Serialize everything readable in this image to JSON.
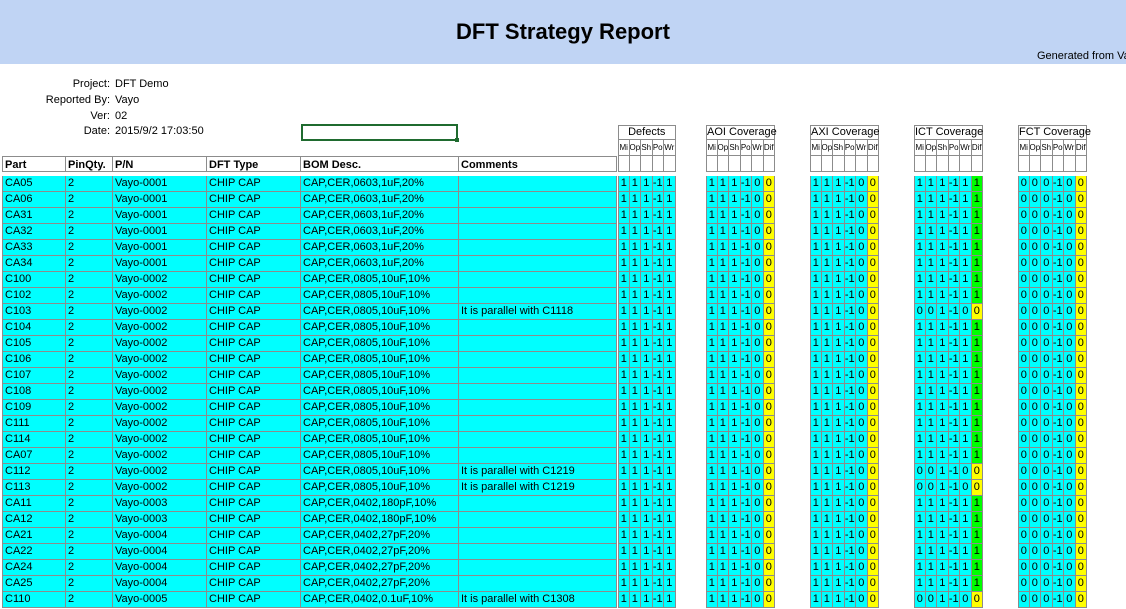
{
  "report": {
    "title": "DFT Strategy Report",
    "generated": "Generated from Va"
  },
  "meta": [
    {
      "label": "Project:",
      "value": "DFT Demo"
    },
    {
      "label": "Reported By:",
      "value": "Vayo"
    },
    {
      "label": "Ver:",
      "value": "02"
    },
    {
      "label": "Date:",
      "value": "2015/9/2 17:03:50"
    }
  ],
  "columns": {
    "part": "Part",
    "pinqty": "PinQty.",
    "pn": "P/N",
    "dft_type": "DFT Type",
    "bom_desc": "BOM Desc.",
    "comments": "Comments"
  },
  "groups": [
    {
      "title": "Defects",
      "subs": [
        "Mi",
        "Op",
        "Sh",
        "Po",
        "Wr"
      ]
    },
    {
      "title": "AOI Coverage",
      "subs": [
        "Mi",
        "Op",
        "Sh",
        "Po",
        "Wr",
        "Dif"
      ]
    },
    {
      "title": "AXI Coverage",
      "subs": [
        "Mi",
        "Op",
        "Sh",
        "Po",
        "Wr",
        "Dif"
      ]
    },
    {
      "title": "ICT Coverage",
      "subs": [
        "Mi",
        "Op",
        "Sh",
        "Po",
        "Wr",
        "Dif"
      ]
    },
    {
      "title": "FCT Coverage",
      "subs": [
        "Mi",
        "Op",
        "Sh",
        "Po",
        "Wr",
        "Dif"
      ]
    }
  ],
  "rows": [
    {
      "part": "CA05",
      "pinqty": "2",
      "pn": "Vayo-0001",
      "type": "CHIP CAP",
      "desc": "CAP,CER,0603,1uF,20%",
      "comment": "",
      "defects": [
        "1",
        "1",
        "1",
        "-1",
        "1"
      ],
      "aoi": [
        "1",
        "1",
        "1",
        "-1",
        "0",
        "0"
      ],
      "axi": [
        "1",
        "1",
        "1",
        "-1",
        "0",
        "0"
      ],
      "ict": [
        "1",
        "1",
        "1",
        "-1",
        "1",
        "1"
      ],
      "fct": [
        "0",
        "0",
        "0",
        "-1",
        "0",
        "0"
      ]
    },
    {
      "part": "CA06",
      "pinqty": "2",
      "pn": "Vayo-0001",
      "type": "CHIP CAP",
      "desc": "CAP,CER,0603,1uF,20%",
      "comment": "",
      "defects": [
        "1",
        "1",
        "1",
        "-1",
        "1"
      ],
      "aoi": [
        "1",
        "1",
        "1",
        "-1",
        "0",
        "0"
      ],
      "axi": [
        "1",
        "1",
        "1",
        "-1",
        "0",
        "0"
      ],
      "ict": [
        "1",
        "1",
        "1",
        "-1",
        "1",
        "1"
      ],
      "fct": [
        "0",
        "0",
        "0",
        "-1",
        "0",
        "0"
      ]
    },
    {
      "part": "CA31",
      "pinqty": "2",
      "pn": "Vayo-0001",
      "type": "CHIP CAP",
      "desc": "CAP,CER,0603,1uF,20%",
      "comment": "",
      "defects": [
        "1",
        "1",
        "1",
        "-1",
        "1"
      ],
      "aoi": [
        "1",
        "1",
        "1",
        "-1",
        "0",
        "0"
      ],
      "axi": [
        "1",
        "1",
        "1",
        "-1",
        "0",
        "0"
      ],
      "ict": [
        "1",
        "1",
        "1",
        "-1",
        "1",
        "1"
      ],
      "fct": [
        "0",
        "0",
        "0",
        "-1",
        "0",
        "0"
      ]
    },
    {
      "part": "CA32",
      "pinqty": "2",
      "pn": "Vayo-0001",
      "type": "CHIP CAP",
      "desc": "CAP,CER,0603,1uF,20%",
      "comment": "",
      "defects": [
        "1",
        "1",
        "1",
        "-1",
        "1"
      ],
      "aoi": [
        "1",
        "1",
        "1",
        "-1",
        "0",
        "0"
      ],
      "axi": [
        "1",
        "1",
        "1",
        "-1",
        "0",
        "0"
      ],
      "ict": [
        "1",
        "1",
        "1",
        "-1",
        "1",
        "1"
      ],
      "fct": [
        "0",
        "0",
        "0",
        "-1",
        "0",
        "0"
      ]
    },
    {
      "part": "CA33",
      "pinqty": "2",
      "pn": "Vayo-0001",
      "type": "CHIP CAP",
      "desc": "CAP,CER,0603,1uF,20%",
      "comment": "",
      "defects": [
        "1",
        "1",
        "1",
        "-1",
        "1"
      ],
      "aoi": [
        "1",
        "1",
        "1",
        "-1",
        "0",
        "0"
      ],
      "axi": [
        "1",
        "1",
        "1",
        "-1",
        "0",
        "0"
      ],
      "ict": [
        "1",
        "1",
        "1",
        "-1",
        "1",
        "1"
      ],
      "fct": [
        "0",
        "0",
        "0",
        "-1",
        "0",
        "0"
      ]
    },
    {
      "part": "CA34",
      "pinqty": "2",
      "pn": "Vayo-0001",
      "type": "CHIP CAP",
      "desc": "CAP,CER,0603,1uF,20%",
      "comment": "",
      "defects": [
        "1",
        "1",
        "1",
        "-1",
        "1"
      ],
      "aoi": [
        "1",
        "1",
        "1",
        "-1",
        "0",
        "0"
      ],
      "axi": [
        "1",
        "1",
        "1",
        "-1",
        "0",
        "0"
      ],
      "ict": [
        "1",
        "1",
        "1",
        "-1",
        "1",
        "1"
      ],
      "fct": [
        "0",
        "0",
        "0",
        "-1",
        "0",
        "0"
      ]
    },
    {
      "part": "C100",
      "pinqty": "2",
      "pn": "Vayo-0002",
      "type": "CHIP CAP",
      "desc": "CAP,CER,0805,10uF,10%",
      "comment": "",
      "defects": [
        "1",
        "1",
        "1",
        "-1",
        "1"
      ],
      "aoi": [
        "1",
        "1",
        "1",
        "-1",
        "0",
        "0"
      ],
      "axi": [
        "1",
        "1",
        "1",
        "-1",
        "0",
        "0"
      ],
      "ict": [
        "1",
        "1",
        "1",
        "-1",
        "1",
        "1"
      ],
      "fct": [
        "0",
        "0",
        "0",
        "-1",
        "0",
        "0"
      ]
    },
    {
      "part": "C102",
      "pinqty": "2",
      "pn": "Vayo-0002",
      "type": "CHIP CAP",
      "desc": "CAP,CER,0805,10uF,10%",
      "comment": "",
      "defects": [
        "1",
        "1",
        "1",
        "-1",
        "1"
      ],
      "aoi": [
        "1",
        "1",
        "1",
        "-1",
        "0",
        "0"
      ],
      "axi": [
        "1",
        "1",
        "1",
        "-1",
        "0",
        "0"
      ],
      "ict": [
        "1",
        "1",
        "1",
        "-1",
        "1",
        "1"
      ],
      "fct": [
        "0",
        "0",
        "0",
        "-1",
        "0",
        "0"
      ]
    },
    {
      "part": "C103",
      "pinqty": "2",
      "pn": "Vayo-0002",
      "type": "CHIP CAP",
      "desc": "CAP,CER,0805,10uF,10%",
      "comment": "It is parallel with C1118",
      "defects": [
        "1",
        "1",
        "1",
        "-1",
        "1"
      ],
      "aoi": [
        "1",
        "1",
        "1",
        "-1",
        "0",
        "0"
      ],
      "axi": [
        "1",
        "1",
        "1",
        "-1",
        "0",
        "0"
      ],
      "ict": [
        "0",
        "0",
        "1",
        "-1",
        "0",
        "0"
      ],
      "fct": [
        "0",
        "0",
        "0",
        "-1",
        "0",
        "0"
      ]
    },
    {
      "part": "C104",
      "pinqty": "2",
      "pn": "Vayo-0002",
      "type": "CHIP CAP",
      "desc": "CAP,CER,0805,10uF,10%",
      "comment": "",
      "defects": [
        "1",
        "1",
        "1",
        "-1",
        "1"
      ],
      "aoi": [
        "1",
        "1",
        "1",
        "-1",
        "0",
        "0"
      ],
      "axi": [
        "1",
        "1",
        "1",
        "-1",
        "0",
        "0"
      ],
      "ict": [
        "1",
        "1",
        "1",
        "-1",
        "1",
        "1"
      ],
      "fct": [
        "0",
        "0",
        "0",
        "-1",
        "0",
        "0"
      ]
    },
    {
      "part": "C105",
      "pinqty": "2",
      "pn": "Vayo-0002",
      "type": "CHIP CAP",
      "desc": "CAP,CER,0805,10uF,10%",
      "comment": "",
      "defects": [
        "1",
        "1",
        "1",
        "-1",
        "1"
      ],
      "aoi": [
        "1",
        "1",
        "1",
        "-1",
        "0",
        "0"
      ],
      "axi": [
        "1",
        "1",
        "1",
        "-1",
        "0",
        "0"
      ],
      "ict": [
        "1",
        "1",
        "1",
        "-1",
        "1",
        "1"
      ],
      "fct": [
        "0",
        "0",
        "0",
        "-1",
        "0",
        "0"
      ]
    },
    {
      "part": "C106",
      "pinqty": "2",
      "pn": "Vayo-0002",
      "type": "CHIP CAP",
      "desc": "CAP,CER,0805,10uF,10%",
      "comment": "",
      "defects": [
        "1",
        "1",
        "1",
        "-1",
        "1"
      ],
      "aoi": [
        "1",
        "1",
        "1",
        "-1",
        "0",
        "0"
      ],
      "axi": [
        "1",
        "1",
        "1",
        "-1",
        "0",
        "0"
      ],
      "ict": [
        "1",
        "1",
        "1",
        "-1",
        "1",
        "1"
      ],
      "fct": [
        "0",
        "0",
        "0",
        "-1",
        "0",
        "0"
      ]
    },
    {
      "part": "C107",
      "pinqty": "2",
      "pn": "Vayo-0002",
      "type": "CHIP CAP",
      "desc": "CAP,CER,0805,10uF,10%",
      "comment": "",
      "defects": [
        "1",
        "1",
        "1",
        "-1",
        "1"
      ],
      "aoi": [
        "1",
        "1",
        "1",
        "-1",
        "0",
        "0"
      ],
      "axi": [
        "1",
        "1",
        "1",
        "-1",
        "0",
        "0"
      ],
      "ict": [
        "1",
        "1",
        "1",
        "-1",
        "1",
        "1"
      ],
      "fct": [
        "0",
        "0",
        "0",
        "-1",
        "0",
        "0"
      ]
    },
    {
      "part": "C108",
      "pinqty": "2",
      "pn": "Vayo-0002",
      "type": "CHIP CAP",
      "desc": "CAP,CER,0805,10uF,10%",
      "comment": "",
      "defects": [
        "1",
        "1",
        "1",
        "-1",
        "1"
      ],
      "aoi": [
        "1",
        "1",
        "1",
        "-1",
        "0",
        "0"
      ],
      "axi": [
        "1",
        "1",
        "1",
        "-1",
        "0",
        "0"
      ],
      "ict": [
        "1",
        "1",
        "1",
        "-1",
        "1",
        "1"
      ],
      "fct": [
        "0",
        "0",
        "0",
        "-1",
        "0",
        "0"
      ]
    },
    {
      "part": "C109",
      "pinqty": "2",
      "pn": "Vayo-0002",
      "type": "CHIP CAP",
      "desc": "CAP,CER,0805,10uF,10%",
      "comment": "",
      "defects": [
        "1",
        "1",
        "1",
        "-1",
        "1"
      ],
      "aoi": [
        "1",
        "1",
        "1",
        "-1",
        "0",
        "0"
      ],
      "axi": [
        "1",
        "1",
        "1",
        "-1",
        "0",
        "0"
      ],
      "ict": [
        "1",
        "1",
        "1",
        "-1",
        "1",
        "1"
      ],
      "fct": [
        "0",
        "0",
        "0",
        "-1",
        "0",
        "0"
      ]
    },
    {
      "part": "C111",
      "pinqty": "2",
      "pn": "Vayo-0002",
      "type": "CHIP CAP",
      "desc": "CAP,CER,0805,10uF,10%",
      "comment": "",
      "defects": [
        "1",
        "1",
        "1",
        "-1",
        "1"
      ],
      "aoi": [
        "1",
        "1",
        "1",
        "-1",
        "0",
        "0"
      ],
      "axi": [
        "1",
        "1",
        "1",
        "-1",
        "0",
        "0"
      ],
      "ict": [
        "1",
        "1",
        "1",
        "-1",
        "1",
        "1"
      ],
      "fct": [
        "0",
        "0",
        "0",
        "-1",
        "0",
        "0"
      ]
    },
    {
      "part": "C114",
      "pinqty": "2",
      "pn": "Vayo-0002",
      "type": "CHIP CAP",
      "desc": "CAP,CER,0805,10uF,10%",
      "comment": "",
      "defects": [
        "1",
        "1",
        "1",
        "-1",
        "1"
      ],
      "aoi": [
        "1",
        "1",
        "1",
        "-1",
        "0",
        "0"
      ],
      "axi": [
        "1",
        "1",
        "1",
        "-1",
        "0",
        "0"
      ],
      "ict": [
        "1",
        "1",
        "1",
        "-1",
        "1",
        "1"
      ],
      "fct": [
        "0",
        "0",
        "0",
        "-1",
        "0",
        "0"
      ]
    },
    {
      "part": "CA07",
      "pinqty": "2",
      "pn": "Vayo-0002",
      "type": "CHIP CAP",
      "desc": "CAP,CER,0805,10uF,10%",
      "comment": "",
      "defects": [
        "1",
        "1",
        "1",
        "-1",
        "1"
      ],
      "aoi": [
        "1",
        "1",
        "1",
        "-1",
        "0",
        "0"
      ],
      "axi": [
        "1",
        "1",
        "1",
        "-1",
        "0",
        "0"
      ],
      "ict": [
        "1",
        "1",
        "1",
        "-1",
        "1",
        "1"
      ],
      "fct": [
        "0",
        "0",
        "0",
        "-1",
        "0",
        "0"
      ]
    },
    {
      "part": "C112",
      "pinqty": "2",
      "pn": "Vayo-0002",
      "type": "CHIP CAP",
      "desc": "CAP,CER,0805,10uF,10%",
      "comment": "It is parallel with C1219",
      "defects": [
        "1",
        "1",
        "1",
        "-1",
        "1"
      ],
      "aoi": [
        "1",
        "1",
        "1",
        "-1",
        "0",
        "0"
      ],
      "axi": [
        "1",
        "1",
        "1",
        "-1",
        "0",
        "0"
      ],
      "ict": [
        "0",
        "0",
        "1",
        "-1",
        "0",
        "0"
      ],
      "fct": [
        "0",
        "0",
        "0",
        "-1",
        "0",
        "0"
      ]
    },
    {
      "part": "C113",
      "pinqty": "2",
      "pn": "Vayo-0002",
      "type": "CHIP CAP",
      "desc": "CAP,CER,0805,10uF,10%",
      "comment": "It is parallel with C1219",
      "defects": [
        "1",
        "1",
        "1",
        "-1",
        "1"
      ],
      "aoi": [
        "1",
        "1",
        "1",
        "-1",
        "0",
        "0"
      ],
      "axi": [
        "1",
        "1",
        "1",
        "-1",
        "0",
        "0"
      ],
      "ict": [
        "0",
        "0",
        "1",
        "-1",
        "0",
        "0"
      ],
      "fct": [
        "0",
        "0",
        "0",
        "-1",
        "0",
        "0"
      ]
    },
    {
      "part": "CA11",
      "pinqty": "2",
      "pn": "Vayo-0003",
      "type": "CHIP CAP",
      "desc": "CAP,CER,0402,180pF,10%",
      "comment": "",
      "defects": [
        "1",
        "1",
        "1",
        "-1",
        "1"
      ],
      "aoi": [
        "1",
        "1",
        "1",
        "-1",
        "0",
        "0"
      ],
      "axi": [
        "1",
        "1",
        "1",
        "-1",
        "0",
        "0"
      ],
      "ict": [
        "1",
        "1",
        "1",
        "-1",
        "1",
        "1"
      ],
      "fct": [
        "0",
        "0",
        "0",
        "-1",
        "0",
        "0"
      ]
    },
    {
      "part": "CA12",
      "pinqty": "2",
      "pn": "Vayo-0003",
      "type": "CHIP CAP",
      "desc": "CAP,CER,0402,180pF,10%",
      "comment": "",
      "defects": [
        "1",
        "1",
        "1",
        "-1",
        "1"
      ],
      "aoi": [
        "1",
        "1",
        "1",
        "-1",
        "0",
        "0"
      ],
      "axi": [
        "1",
        "1",
        "1",
        "-1",
        "0",
        "0"
      ],
      "ict": [
        "1",
        "1",
        "1",
        "-1",
        "1",
        "1"
      ],
      "fct": [
        "0",
        "0",
        "0",
        "-1",
        "0",
        "0"
      ]
    },
    {
      "part": "CA21",
      "pinqty": "2",
      "pn": "Vayo-0004",
      "type": "CHIP CAP",
      "desc": "CAP,CER,0402,27pF,20%",
      "comment": "",
      "defects": [
        "1",
        "1",
        "1",
        "-1",
        "1"
      ],
      "aoi": [
        "1",
        "1",
        "1",
        "-1",
        "0",
        "0"
      ],
      "axi": [
        "1",
        "1",
        "1",
        "-1",
        "0",
        "0"
      ],
      "ict": [
        "1",
        "1",
        "1",
        "-1",
        "1",
        "1"
      ],
      "fct": [
        "0",
        "0",
        "0",
        "-1",
        "0",
        "0"
      ]
    },
    {
      "part": "CA22",
      "pinqty": "2",
      "pn": "Vayo-0004",
      "type": "CHIP CAP",
      "desc": "CAP,CER,0402,27pF,20%",
      "comment": "",
      "defects": [
        "1",
        "1",
        "1",
        "-1",
        "1"
      ],
      "aoi": [
        "1",
        "1",
        "1",
        "-1",
        "0",
        "0"
      ],
      "axi": [
        "1",
        "1",
        "1",
        "-1",
        "0",
        "0"
      ],
      "ict": [
        "1",
        "1",
        "1",
        "-1",
        "1",
        "1"
      ],
      "fct": [
        "0",
        "0",
        "0",
        "-1",
        "0",
        "0"
      ]
    },
    {
      "part": "CA24",
      "pinqty": "2",
      "pn": "Vayo-0004",
      "type": "CHIP CAP",
      "desc": "CAP,CER,0402,27pF,20%",
      "comment": "",
      "defects": [
        "1",
        "1",
        "1",
        "-1",
        "1"
      ],
      "aoi": [
        "1",
        "1",
        "1",
        "-1",
        "0",
        "0"
      ],
      "axi": [
        "1",
        "1",
        "1",
        "-1",
        "0",
        "0"
      ],
      "ict": [
        "1",
        "1",
        "1",
        "-1",
        "1",
        "1"
      ],
      "fct": [
        "0",
        "0",
        "0",
        "-1",
        "0",
        "0"
      ]
    },
    {
      "part": "CA25",
      "pinqty": "2",
      "pn": "Vayo-0004",
      "type": "CHIP CAP",
      "desc": "CAP,CER,0402,27pF,20%",
      "comment": "",
      "defects": [
        "1",
        "1",
        "1",
        "-1",
        "1"
      ],
      "aoi": [
        "1",
        "1",
        "1",
        "-1",
        "0",
        "0"
      ],
      "axi": [
        "1",
        "1",
        "1",
        "-1",
        "0",
        "0"
      ],
      "ict": [
        "1",
        "1",
        "1",
        "-1",
        "1",
        "1"
      ],
      "fct": [
        "0",
        "0",
        "0",
        "-1",
        "0",
        "0"
      ]
    },
    {
      "part": "C110",
      "pinqty": "2",
      "pn": "Vayo-0005",
      "type": "CHIP CAP",
      "desc": "CAP,CER,0402,0.1uF,10%",
      "comment": "It is parallel with C1308",
      "defects": [
        "1",
        "1",
        "1",
        "-1",
        "1"
      ],
      "aoi": [
        "1",
        "1",
        "1",
        "-1",
        "0",
        "0"
      ],
      "axi": [
        "1",
        "1",
        "1",
        "-1",
        "0",
        "0"
      ],
      "ict": [
        "0",
        "0",
        "1",
        "-1",
        "0",
        "0"
      ],
      "fct": [
        "0",
        "0",
        "0",
        "-1",
        "0",
        "0"
      ]
    }
  ]
}
